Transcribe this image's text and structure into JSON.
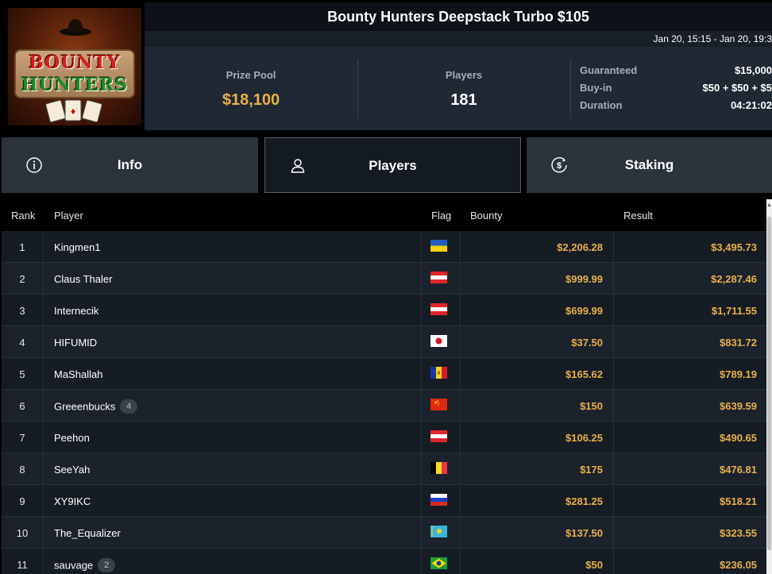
{
  "logo": {
    "line1": "BOUNTY",
    "line2": "HUNTERS"
  },
  "header": {
    "title": "Bounty Hunters Deepstack Turbo $105",
    "dates": "Jan 20, 15:15 - Jan 20, 19:3"
  },
  "stats": {
    "prize_label": "Prize Pool",
    "prize_value": "$18,100",
    "players_label": "Players",
    "players_value": "181",
    "details": [
      {
        "key": "Guaranteed",
        "value": "$15,000"
      },
      {
        "key": "Buy-in",
        "value": "$50 + $50 + $5"
      },
      {
        "key": "Duration",
        "value": "04:21:02"
      }
    ]
  },
  "tabs": [
    {
      "label": "Info",
      "icon": "info-icon",
      "active": false
    },
    {
      "label": "Players",
      "icon": "user-icon",
      "active": true
    },
    {
      "label": "Staking",
      "icon": "dollar-coin-icon",
      "active": false
    }
  ],
  "table": {
    "columns": {
      "rank": "Rank",
      "player": "Player",
      "flag": "Flag",
      "bounty": "Bounty",
      "result": "Result"
    },
    "rows": [
      {
        "rank": "1",
        "player": "Kingmen1",
        "badge": null,
        "flag": "ukraine",
        "bounty": "$2,206.28",
        "result": "$3,495.73"
      },
      {
        "rank": "2",
        "player": "Claus Thaler",
        "badge": null,
        "flag": "austria",
        "bounty": "$999.99",
        "result": "$2,287.46"
      },
      {
        "rank": "3",
        "player": "Internecik",
        "badge": null,
        "flag": "austria",
        "bounty": "$699.99",
        "result": "$1,711.55"
      },
      {
        "rank": "4",
        "player": "HIFUMID",
        "badge": null,
        "flag": "japan",
        "bounty": "$37.50",
        "result": "$831.72"
      },
      {
        "rank": "5",
        "player": "MaShallah",
        "badge": null,
        "flag": "andorra",
        "bounty": "$165.62",
        "result": "$789.19"
      },
      {
        "rank": "6",
        "player": "Greeenbucks",
        "badge": "4",
        "flag": "china",
        "bounty": "$150",
        "result": "$639.59"
      },
      {
        "rank": "7",
        "player": "Peehon",
        "badge": null,
        "flag": "austria",
        "bounty": "$106.25",
        "result": "$490.65"
      },
      {
        "rank": "8",
        "player": "SeeYah",
        "badge": null,
        "flag": "belgium",
        "bounty": "$175",
        "result": "$476.81"
      },
      {
        "rank": "9",
        "player": "XY9IKC",
        "badge": null,
        "flag": "russia",
        "bounty": "$281.25",
        "result": "$518.21"
      },
      {
        "rank": "10",
        "player": "The_Equalizer",
        "badge": null,
        "flag": "kazakhstan",
        "bounty": "$137.50",
        "result": "$323.55"
      },
      {
        "rank": "11",
        "player": "sauvage",
        "badge": "2",
        "flag": "brazil",
        "bounty": "$50",
        "result": "$236.05"
      }
    ]
  },
  "colors": {
    "accent_gold": "#e8b04b",
    "bg_dark": "#141a21",
    "panel": "#1f2833"
  }
}
